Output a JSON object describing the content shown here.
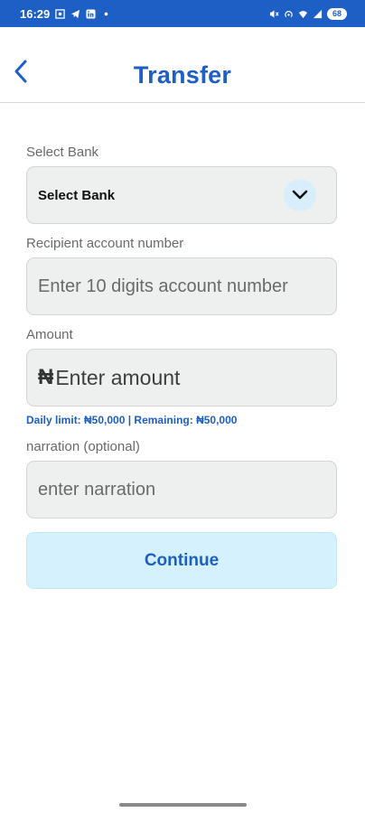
{
  "status_bar": {
    "time": "16:29",
    "battery": "68",
    "icons": [
      "screenshot-icon",
      "telegram-icon",
      "linkedin-icon",
      "dot-icon",
      "mute-icon",
      "hotspot-icon",
      "wifi-icon",
      "signal-icon",
      "battery-icon"
    ]
  },
  "header": {
    "title": "Transfer",
    "back_icon": "chevron-left-icon"
  },
  "form": {
    "bank": {
      "label": "Select Bank",
      "value": "Select Bank",
      "dropdown_icon": "chevron-down-icon"
    },
    "account": {
      "label": "Recipient account number",
      "placeholder": "Enter 10 digits account number"
    },
    "amount": {
      "label": "Amount",
      "currency_symbol": "₦",
      "placeholder": "Enter amount",
      "limit_text": "Daily limit: ₦50,000 | Remaining: ₦50,000"
    },
    "narration": {
      "label": "narration (optional)",
      "placeholder": "enter narration"
    }
  },
  "continue_label": "Continue",
  "colors": {
    "primary": "#1d5fc4",
    "button_bg": "#d4f1fd",
    "field_bg": "#eef0f0"
  }
}
